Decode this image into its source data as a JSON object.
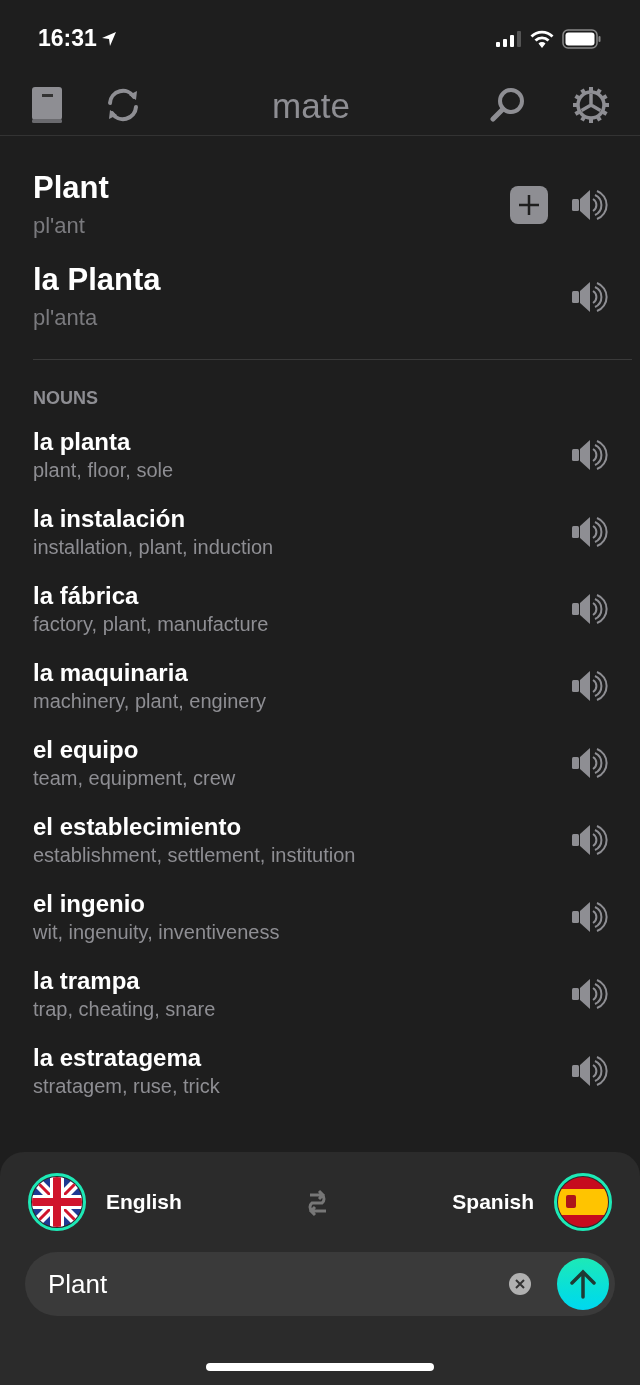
{
  "status_bar": {
    "time": "16:31"
  },
  "app_bar": {
    "title": "mate"
  },
  "main_translations": [
    {
      "word": "Plant",
      "transcription": "pl'ant",
      "can_add": true
    },
    {
      "word": "la Planta",
      "transcription": "pl'anta",
      "can_add": false
    }
  ],
  "section_title": "NOUNS",
  "nouns": [
    {
      "word": "la planta",
      "meanings": "plant, floor, sole"
    },
    {
      "word": "la instalación",
      "meanings": "installation, plant, induction"
    },
    {
      "word": "la fábrica",
      "meanings": "factory, plant, manufacture"
    },
    {
      "word": "la maquinaria",
      "meanings": "machinery, plant, enginery"
    },
    {
      "word": "el equipo",
      "meanings": "team, equipment, crew"
    },
    {
      "word": "el establecimiento",
      "meanings": "establishment, settlement, institution"
    },
    {
      "word": "el ingenio",
      "meanings": "wit, ingenuity, inventiveness"
    },
    {
      "word": "la trampa",
      "meanings": "trap, cheating, snare"
    },
    {
      "word": "la estratagema",
      "meanings": "stratagem, ruse, trick"
    }
  ],
  "languages": {
    "source": "English",
    "target": "Spanish"
  },
  "input": {
    "value": "Plant"
  }
}
